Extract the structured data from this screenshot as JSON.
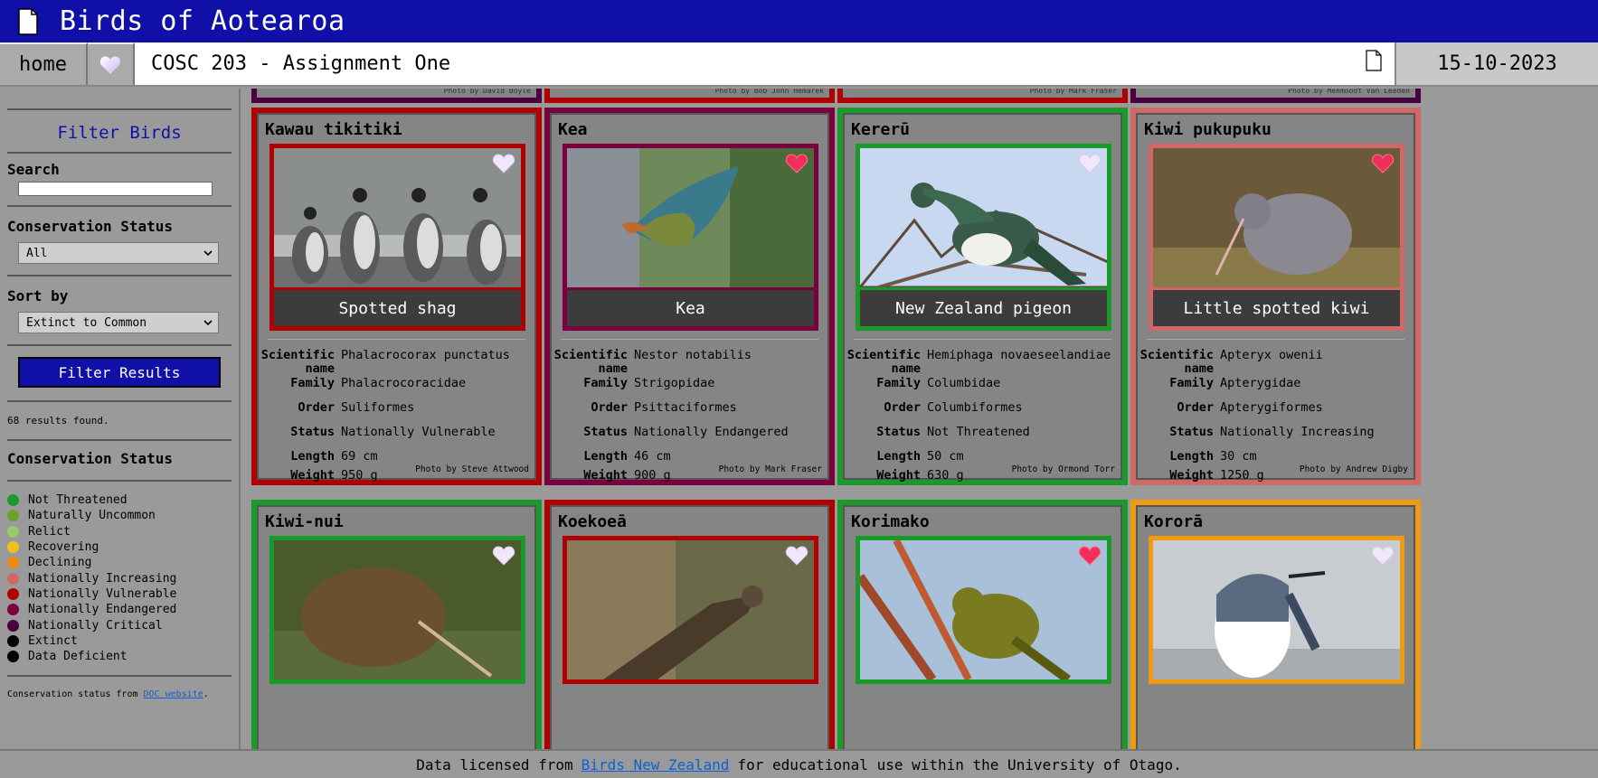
{
  "header": {
    "title": "Birds of Aotearoa"
  },
  "nav": {
    "home": "home",
    "course": "COSC 203 - Assignment One",
    "date": "15-10-2023"
  },
  "sidebar": {
    "filter_title": "Filter Birds",
    "search_label": "Search",
    "search_value": "",
    "status_label": "Conservation Status",
    "status_selected": "All",
    "sort_label": "Sort by",
    "sort_selected": "Extinct to Common",
    "filter_button": "Filter Results",
    "results_text": "68 results found.",
    "legend_title": "Conservation Status",
    "legend": [
      {
        "label": "Not Threatened",
        "color": "#1a9a2a"
      },
      {
        "label": "Naturally Uncommon",
        "color": "#6aa22a"
      },
      {
        "label": "Relict",
        "color": "#9ac86a"
      },
      {
        "label": "Recovering",
        "color": "#f0c020"
      },
      {
        "label": "Declining",
        "color": "#f08a10"
      },
      {
        "label": "Nationally Increasing",
        "color": "#d06868"
      },
      {
        "label": "Nationally Vulnerable",
        "color": "#b00000"
      },
      {
        "label": "Nationally Endangered",
        "color": "#7a0040"
      },
      {
        "label": "Nationally Critical",
        "color": "#4a0040"
      },
      {
        "label": "Extinct",
        "color": "#000000"
      },
      {
        "label": "Data Deficient",
        "color": "#000000"
      }
    ],
    "source_prefix": "Conservation status from ",
    "source_link": "DOC website",
    "source_suffix": "."
  },
  "top_credits": [
    "Photo by David Boyle",
    "Photo by Bob John Hemarek",
    "Photo by Mark Fraser",
    "Photo by Mehmoodt Van Leeden"
  ],
  "top_colors": [
    "#4a0040",
    "#b00000",
    "#b00000",
    "#4a0040"
  ],
  "cards": [
    {
      "name": "Kawau tikitiki",
      "english": "Spotted shag",
      "scientific": "Phalacrocorax punctatus",
      "family": "Phalacrocoracidae",
      "order": "Suliformes",
      "status": "Nationally Vulnerable",
      "length": "69 cm",
      "weight": "950 g",
      "credit": "Photo by Steve Attwood",
      "color": "#b00000",
      "fav": false,
      "img": "shag"
    },
    {
      "name": "Kea",
      "english": "Kea",
      "scientific": "Nestor notabilis",
      "family": "Strigopidae",
      "order": "Psittaciformes",
      "status": "Nationally Endangered",
      "length": "46 cm",
      "weight": "900 g",
      "credit": "Photo by Mark Fraser",
      "color": "#7a0040",
      "fav": true,
      "img": "kea"
    },
    {
      "name": "Kererū",
      "english": "New Zealand pigeon",
      "scientific": "Hemiphaga novaeseelandiae",
      "family": "Columbidae",
      "order": "Columbiformes",
      "status": "Not Threatened",
      "length": "50 cm",
      "weight": "630 g",
      "credit": "Photo by Ormond Torr",
      "color": "#1a9a2a",
      "fav": false,
      "img": "pigeon"
    },
    {
      "name": "Kiwi pukupuku",
      "english": "Little spotted kiwi",
      "scientific": "Apteryx owenii",
      "family": "Apterygidae",
      "order": "Apterygiformes",
      "status": "Nationally Increasing",
      "length": "30 cm",
      "weight": "1250 g",
      "credit": "Photo by Andrew Digby",
      "color": "#d06868",
      "fav": true,
      "img": "kiwi1"
    },
    {
      "name": "Kiwi-nui",
      "color": "#1a9a2a",
      "fav": false,
      "img": "kiwi2"
    },
    {
      "name": "Koekoeā",
      "color": "#b00000",
      "fav": false,
      "img": "cuckoo"
    },
    {
      "name": "Korimako",
      "color": "#1a9a2a",
      "fav": true,
      "img": "bellbird"
    },
    {
      "name": "Kororā",
      "color": "#f09a10",
      "fav": false,
      "img": "penguin"
    }
  ],
  "labels": {
    "scientific": "Scientific name",
    "family": "Family",
    "order": "Order",
    "status": "Status",
    "length": "Length",
    "weight": "Weight"
  },
  "footer": {
    "prefix": "Data licensed from",
    "link": "Birds New Zealand",
    "suffix": "for educational use within the University of Otago."
  }
}
